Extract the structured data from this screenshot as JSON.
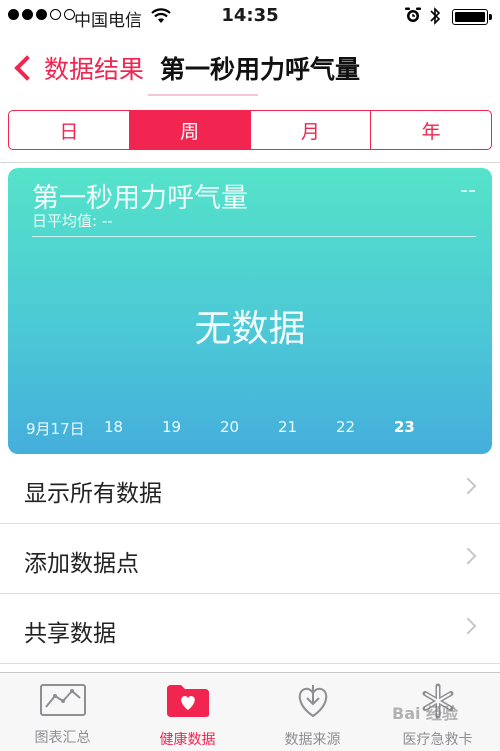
{
  "status_bar": {
    "carrier": "中国电信",
    "time": "14:35"
  },
  "nav": {
    "back_label": "数据结果",
    "title": "第一秒用力呼气量"
  },
  "segments": [
    "日",
    "周",
    "月",
    "年"
  ],
  "selected_segment": "周",
  "card": {
    "title": "第一秒用力呼气量",
    "value": "--",
    "subtitle": "日平均值: --",
    "empty_text": "无数据",
    "x_ticks": [
      "9月17日",
      "18",
      "19",
      "20",
      "21",
      "22",
      "23"
    ],
    "gradient_top": "#55e3c9",
    "gradient_bottom": "#45aedc"
  },
  "list_items": [
    "显示所有数据",
    "添加数据点",
    "共享数据"
  ],
  "tabs": [
    {
      "label": "图表汇总",
      "icon": "chart-icon"
    },
    {
      "label": "健康数据",
      "icon": "health-folder-icon"
    },
    {
      "label": "数据来源",
      "icon": "download-heart-icon"
    },
    {
      "label": "医疗急救卡",
      "icon": "medical-asterisk-icon"
    }
  ],
  "active_tab": "健康数据",
  "watermark": "Bai 经验",
  "accent_color": "#f1254f"
}
